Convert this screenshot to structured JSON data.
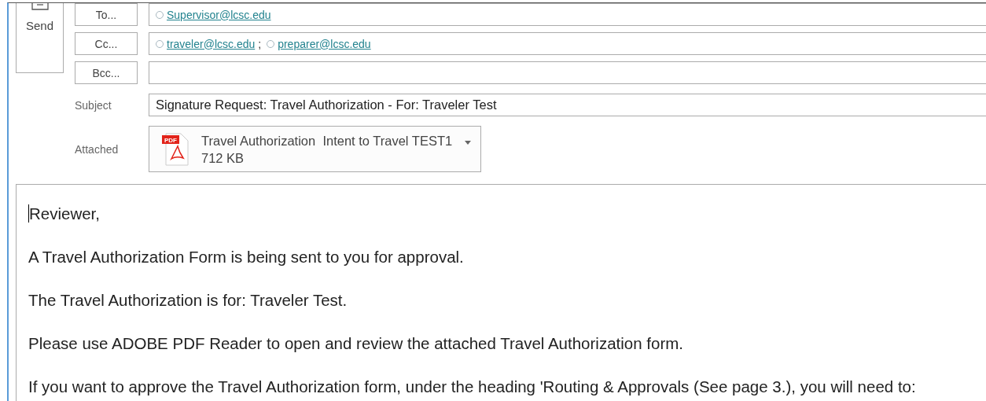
{
  "send_button": {
    "label": "Send"
  },
  "address_rows": [
    {
      "button": "To...",
      "recipients": [
        "Supervisor@lcsc.edu"
      ]
    },
    {
      "button": "Cc...",
      "recipients": [
        "traveler@lcsc.edu",
        "preparer@lcsc.edu"
      ],
      "separator": ";"
    },
    {
      "button": "Bcc...",
      "recipients": []
    }
  ],
  "subject": {
    "label": "Subject",
    "value": "Signature Request: Travel Authorization - For: Traveler Test"
  },
  "attachment": {
    "label": "Attached",
    "name": "Travel Authorization  Intent to Travel TEST1",
    "size": "712 KB",
    "badge": "PDF"
  },
  "body": {
    "paragraphs": [
      "Reviewer,",
      "A Travel Authorization Form is being sent to you for approval.",
      "The Travel Authorization is for: Traveler Test.",
      "Please use ADOBE PDF Reader to open and review the attached Travel Authorization form.",
      "If you want to approve the Travel Authorization form, under the heading 'Routing & Approvals (See page 3.), you will need to:"
    ]
  }
}
